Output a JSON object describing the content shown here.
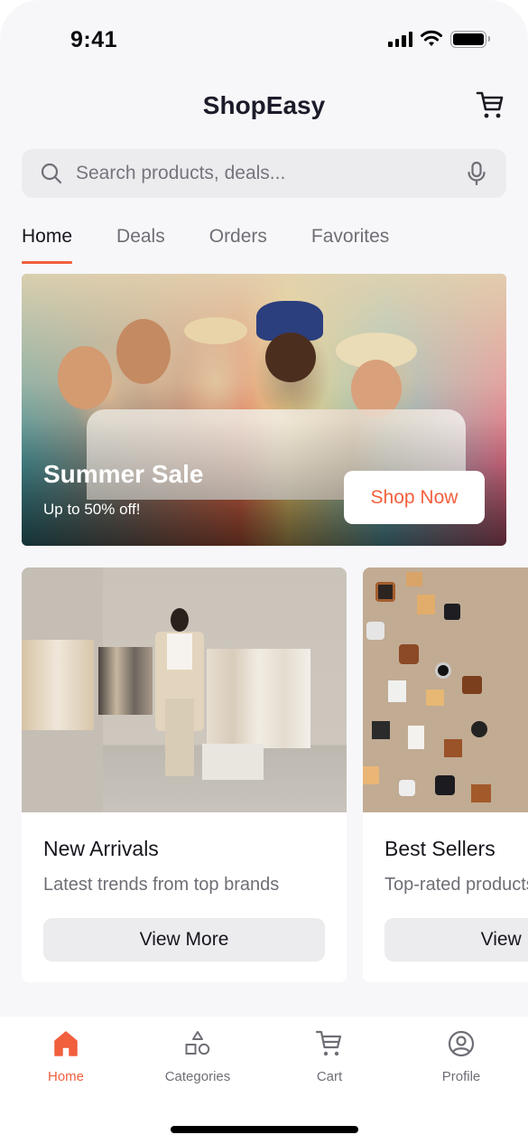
{
  "status_bar": {
    "time": "9:41"
  },
  "header": {
    "title": "ShopEasy",
    "cart_icon": "cart-icon"
  },
  "search": {
    "placeholder": "Search products, deals...",
    "value": "",
    "search_icon": "search-icon",
    "mic_icon": "microphone-icon"
  },
  "tabs": [
    {
      "label": "Home",
      "active": true
    },
    {
      "label": "Deals",
      "active": false
    },
    {
      "label": "Orders",
      "active": false
    },
    {
      "label": "Favorites",
      "active": false
    }
  ],
  "hero": {
    "title": "Summer Sale",
    "subtitle": "Up to 50% off!",
    "button_label": "Shop Now",
    "image_description": "Group of five smiling friends in summer outfits and hats inside a colorful clothing store"
  },
  "cards": [
    {
      "title": "New Arrivals",
      "description": "Latest trends from top brands",
      "button_label": "View More",
      "image_description": "Woman in beige coat standing in minimalist boutique with clothing racks"
    },
    {
      "title": "Best Sellers",
      "description": "Top-rated products",
      "button_label": "View More",
      "image_description": "Flat lay of assorted gadgets, wallets and accessories on beige background"
    }
  ],
  "bottom_nav": [
    {
      "label": "Home",
      "icon": "home-icon",
      "active": true
    },
    {
      "label": "Categories",
      "icon": "shapes-icon",
      "active": false
    },
    {
      "label": "Cart",
      "icon": "cart-icon",
      "active": false
    },
    {
      "label": "Profile",
      "icon": "profile-icon",
      "active": false
    }
  ],
  "colors": {
    "accent": "#f15f3d",
    "background": "#f7f7f9",
    "muted_text": "#6e6e76",
    "search_bg": "#ececef"
  }
}
